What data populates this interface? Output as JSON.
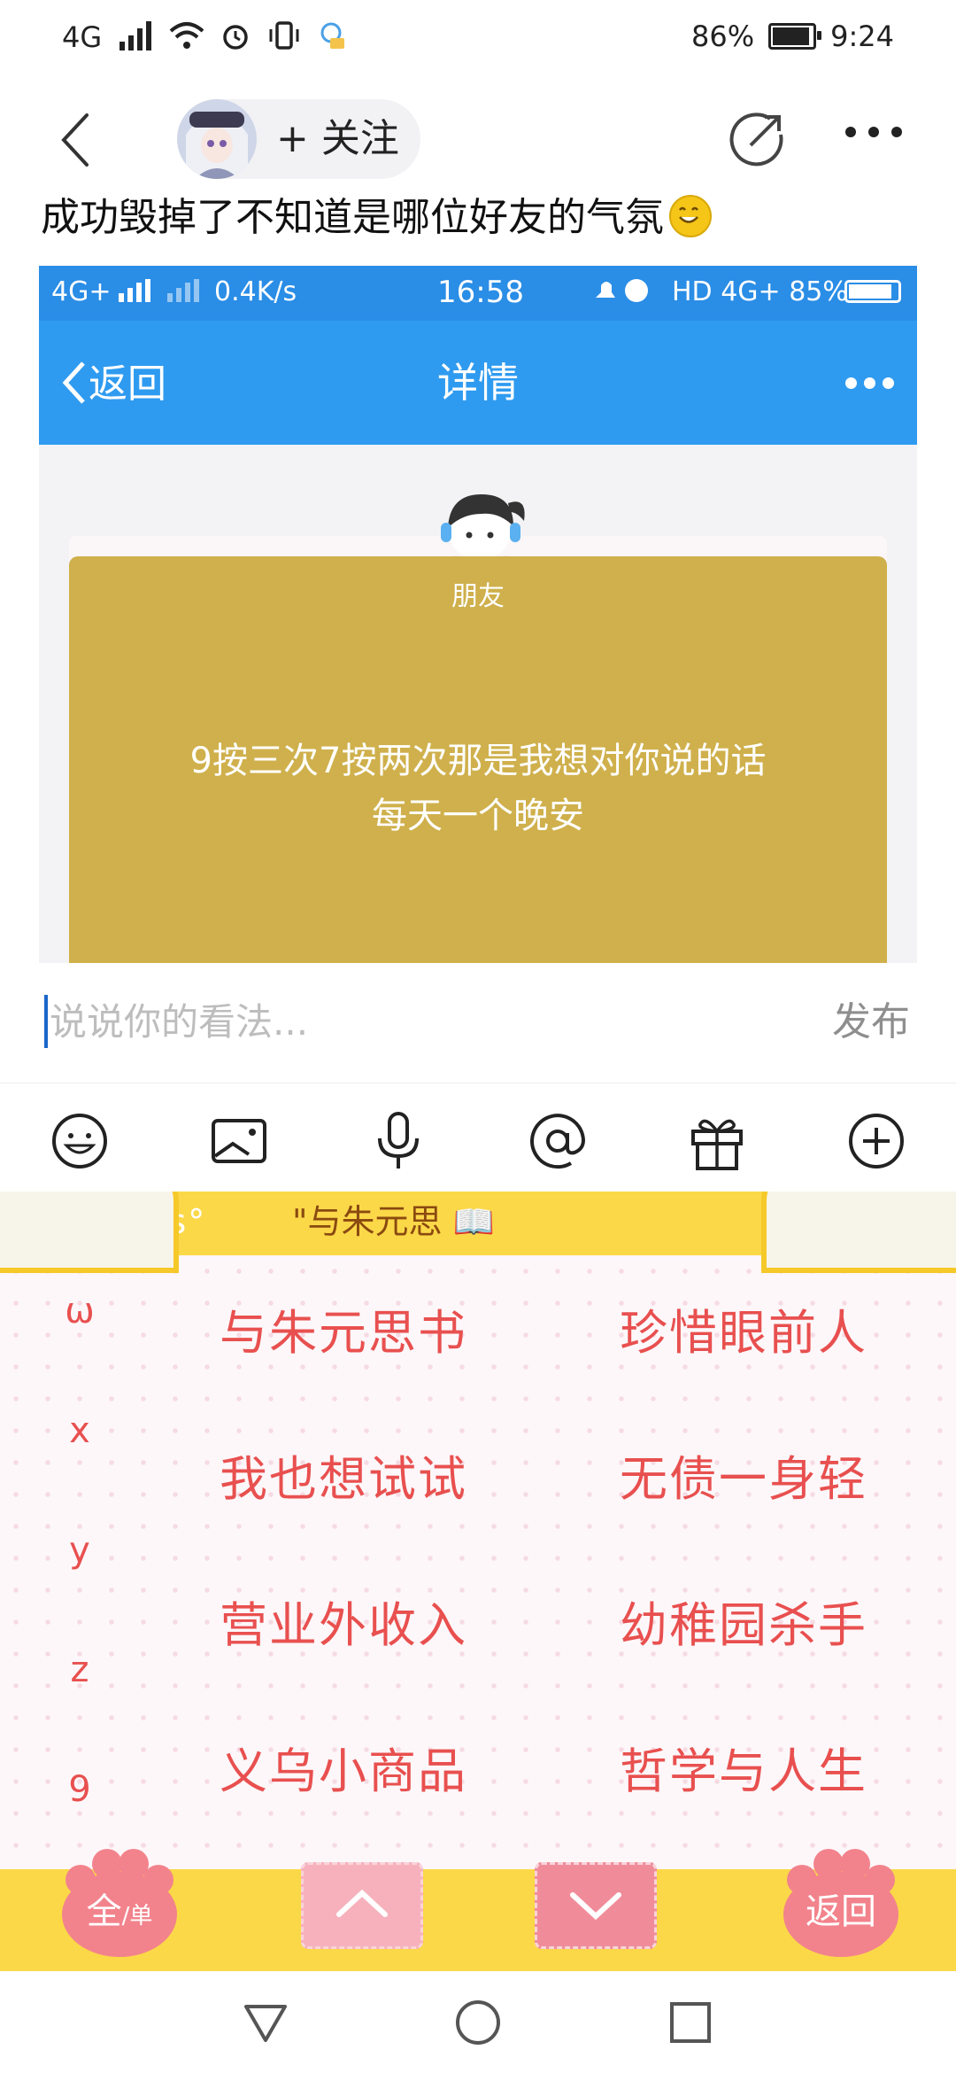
{
  "status_bar": {
    "network": "4G",
    "battery_percent": "86%",
    "battery_level": 0.86,
    "time": "9:24"
  },
  "header": {
    "follow_label": "+ 关注"
  },
  "post": {
    "text": "成功毁掉了不知道是哪位好友的气氛"
  },
  "embedded_screenshot": {
    "status_left": "4G+",
    "speed": "0.4K/s",
    "time": "16:58",
    "status_right": "HD 4G+ 85%",
    "back_label": "返回",
    "title": "详情",
    "card_name": "朋友",
    "card_line1": "9按三次7按两次那是我想对你说的话",
    "card_line2": "每天一个晚安"
  },
  "comment": {
    "placeholder": "说说你的看法...",
    "publish_label": "发布"
  },
  "keyboard": {
    "top_left": "y'z'y's's°",
    "top_title": "\"与朱元思",
    "letters": [
      "ω",
      "x",
      "y",
      "z",
      "9"
    ],
    "candidates_left": [
      "与朱元思书",
      "我也想试试",
      "营业外收入",
      "义乌小商品"
    ],
    "candidates_right": [
      "珍惜眼前人",
      "无债一身轻",
      "幼稚园杀手",
      "哲学与人生"
    ],
    "full_label": "全",
    "single_label": "单",
    "return_label": "返回"
  }
}
